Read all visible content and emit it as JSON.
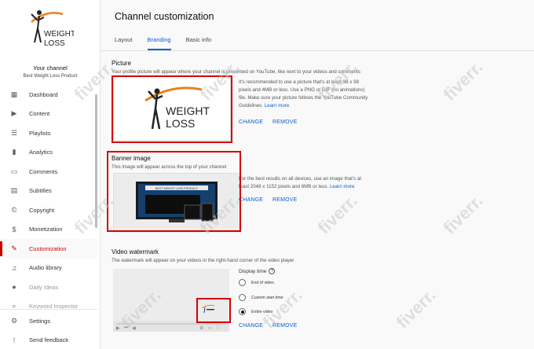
{
  "sidebar": {
    "logo_text": [
      "WEIGHT",
      "LOSS"
    ],
    "channel_label": "Your channel",
    "channel_name": "Best Weight Loss Product",
    "items": [
      {
        "label": "Dashboard",
        "icon": "dashboard-icon",
        "glyph": "▦"
      },
      {
        "label": "Content",
        "icon": "content-icon",
        "glyph": "▶"
      },
      {
        "label": "Playlists",
        "icon": "playlists-icon",
        "glyph": "☰"
      },
      {
        "label": "Analytics",
        "icon": "analytics-icon",
        "glyph": "▮"
      },
      {
        "label": "Comments",
        "icon": "comments-icon",
        "glyph": "▭"
      },
      {
        "label": "Subtitles",
        "icon": "subtitles-icon",
        "glyph": "▤"
      },
      {
        "label": "Copyright",
        "icon": "copyright-icon",
        "glyph": "©"
      },
      {
        "label": "Monetization",
        "icon": "monetization-icon",
        "glyph": "$"
      },
      {
        "label": "Customization",
        "icon": "customization-icon",
        "glyph": "✎"
      },
      {
        "label": "Audio library",
        "icon": "audio-library-icon",
        "glyph": "♫"
      },
      {
        "label": "Daily Ideas",
        "icon": "daily-ideas-icon",
        "glyph": "●"
      },
      {
        "label": "Keyword Inspector",
        "icon": "keyword-inspector-icon",
        "glyph": "⌕"
      }
    ],
    "active_index": 8,
    "bottom": [
      {
        "label": "Settings",
        "icon": "settings-icon",
        "glyph": "⚙"
      },
      {
        "label": "Send feedback",
        "icon": "feedback-icon",
        "glyph": "!"
      }
    ]
  },
  "header": {
    "title": "Channel customization",
    "tabs": [
      "Layout",
      "Branding",
      "Basic info"
    ],
    "active_tab": 1
  },
  "picture": {
    "title": "Picture",
    "desc": "Your profile picture will appear where your channel is presented on YouTube, like next to your videos and comments",
    "note": "It's recommended to use a picture that's at least 98 x 98 pixels and 4MB or less. Use a PNG or GIF (no animations) file. Make sure your picture follows the YouTube Community Guidelines.",
    "learn_more": "Learn more",
    "change": "CHANGE",
    "remove": "REMOVE"
  },
  "banner": {
    "title": "Banner image",
    "desc": "This image will appear across the top of your channel",
    "note": "For the best results on all devices, use an image that's at least 2048 x 1152 pixels and 6MB or less.",
    "learn_more": "Learn more",
    "banner_text": "BEST WEIGHT LOSS PRODUCT",
    "change": "CHANGE",
    "remove": "REMOVE"
  },
  "watermark": {
    "title": "Video watermark",
    "desc": "The watermark will appear on your videos in the right-hand corner of the video player",
    "display_time_label": "Display time",
    "options": [
      "End of video",
      "Custom start time",
      "Entire video"
    ],
    "selected_option": 2,
    "change": "CHANGE",
    "remove": "REMOVE"
  },
  "overlay_text": "fiverr.",
  "colors": {
    "accent": "#065fd4",
    "active": "#cc0000",
    "highlight_box": "#d40000",
    "logo_orange": "#e8811a"
  }
}
